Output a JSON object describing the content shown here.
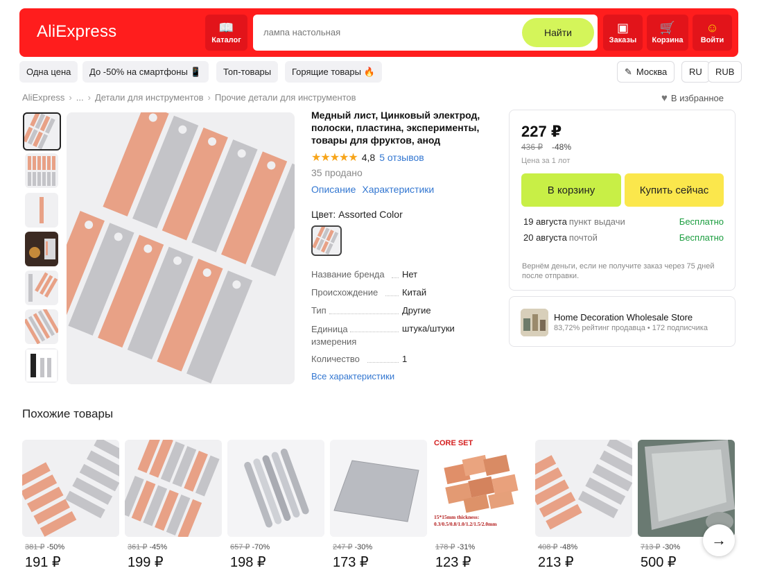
{
  "header": {
    "logo": "AliExpress",
    "catalog_label": "Каталог",
    "search_placeholder": "лампа настольная",
    "search_button": "Найти",
    "orders_label": "Заказы",
    "cart_label": "Корзина",
    "login_label": "Войти"
  },
  "chips": {
    "one_price": "Одна цена",
    "smartphones": "До -50% на смартфоны 📱",
    "top": "Топ-товары",
    "hot": "Горящие товары 🔥",
    "city": "Москва",
    "lang": "RU",
    "currency": "RUB"
  },
  "breadcrumb": {
    "items": [
      "AliExpress",
      "...",
      "Детали для инструментов",
      "Прочие детали для инструментов"
    ],
    "favorite": "В избранное"
  },
  "product": {
    "title": "Медный лист, Цинковый электрод, полоски, пластина, эксперименты, товары для фруктов, анод",
    "stars": "★★★★★",
    "rating": "4,8",
    "reviews": "5 отзывов",
    "sold": "35 продано",
    "tab_description": "Описание",
    "tab_specs": "Характеристики",
    "color_label": "Цвет: Assorted Color",
    "specs": [
      {
        "k": "Название бренда",
        "v": "Нет"
      },
      {
        "k": "Происхождение",
        "v": "Китай"
      },
      {
        "k": "Тип",
        "v": "Другие"
      },
      {
        "k": "Единица измерения",
        "v": "штука/штуки"
      },
      {
        "k": "Количество",
        "v": "1"
      }
    ],
    "all_specs": "Все характеристики"
  },
  "buy": {
    "price": "227 ₽",
    "old_price": "436 ₽",
    "discount": "-48%",
    "per_lot": "Цена за 1 лот",
    "add_to_cart": "В корзину",
    "buy_now": "Купить сейчас",
    "delivery": [
      {
        "date": "19 августа",
        "method": "пункт выдачи",
        "cost": "Бесплатно"
      },
      {
        "date": "20 августа",
        "method": "почтой",
        "cost": "Бесплатно"
      }
    ],
    "refund": "Вернём деньги, если не получите заказ через 75 дней после отправки."
  },
  "store": {
    "name": "Home Decoration Wholesale Store",
    "info": "83,72% рейтинг продавца • 172 подписчика"
  },
  "similar": {
    "title": "Похожие товары",
    "items": [
      {
        "old": "381 ₽",
        "disc": "-50%",
        "price": "191 ₽"
      },
      {
        "old": "361 ₽",
        "disc": "-45%",
        "price": "199 ₽"
      },
      {
        "old": "657 ₽",
        "disc": "-70%",
        "price": "198 ₽"
      },
      {
        "old": "247 ₽",
        "disc": "-30%",
        "price": "173 ₽"
      },
      {
        "old": "178 ₽",
        "disc": "-31%",
        "price": "123 ₽",
        "badge": "CORE SET",
        "caption": "15*15mm thickness: 0.3/0.5/0.8/1.0/1.2/1.5/2.0mm"
      },
      {
        "old": "408 ₽",
        "disc": "-48%",
        "price": "213 ₽"
      },
      {
        "old": "713 ₽",
        "disc": "-30%",
        "price": "500 ₽"
      }
    ]
  }
}
